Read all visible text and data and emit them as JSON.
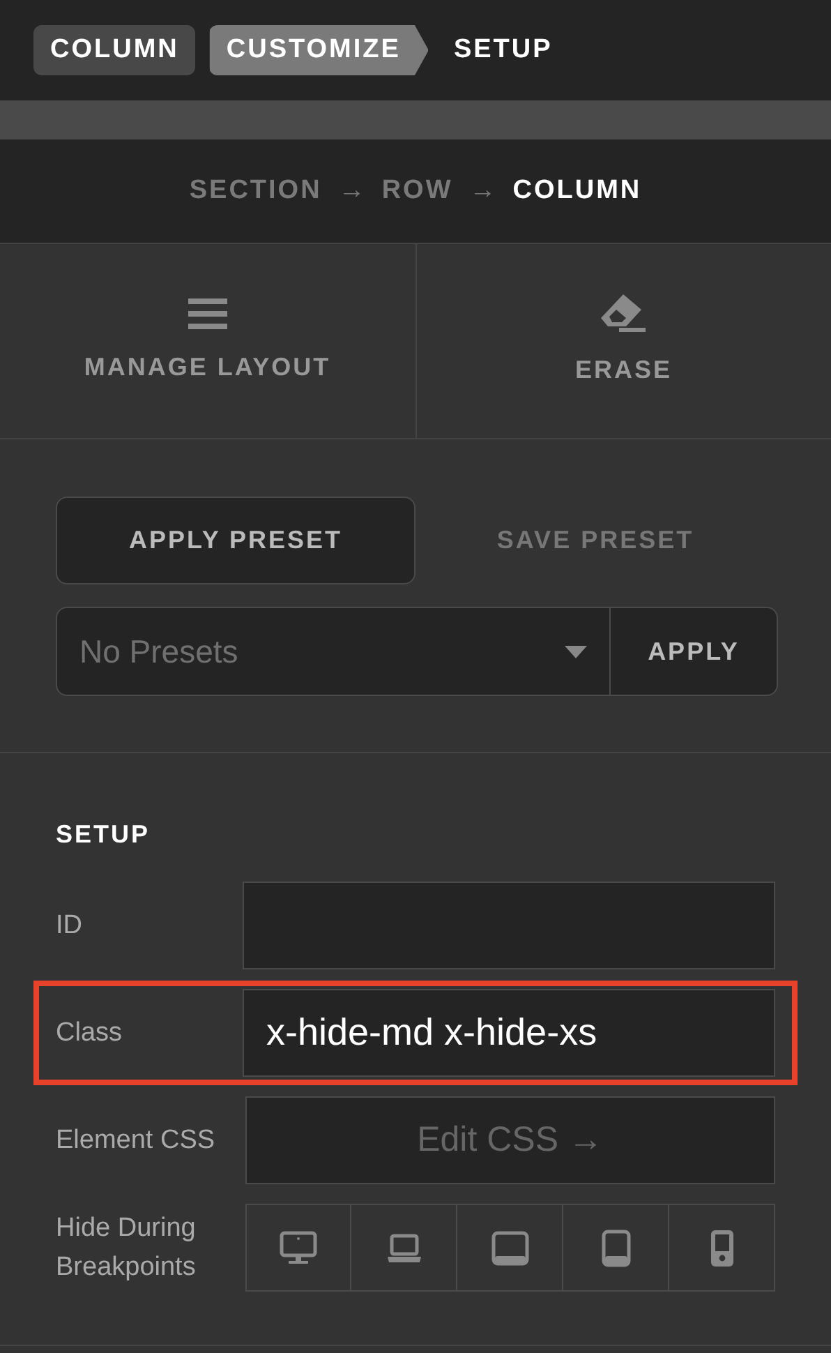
{
  "breadcrumb": [
    {
      "label": "COLUMN",
      "kind": "pill"
    },
    {
      "label": "CUSTOMIZE",
      "kind": "pointer"
    },
    {
      "label": "SETUP",
      "kind": "text"
    }
  ],
  "path": [
    {
      "label": "SECTION",
      "kind": "crumb",
      "selected": false
    },
    {
      "label": "→",
      "kind": "separator"
    },
    {
      "label": "ROW",
      "kind": "crumb",
      "selected": false
    },
    {
      "label": "→",
      "kind": "separator"
    },
    {
      "label": "COLUMN",
      "kind": "crumb",
      "selected": true
    }
  ],
  "actions": [
    {
      "label": "MANAGE LAYOUT",
      "kind": "menu"
    },
    {
      "label": "ERASE",
      "kind": "eraser"
    }
  ],
  "preset_tabs": [
    {
      "label": "APPLY PRESET",
      "selected": true
    },
    {
      "label": "SAVE PRESET",
      "selected": false
    }
  ],
  "preset_select": {
    "placeholder": "No Presets",
    "button": "APPLY"
  },
  "setup": {
    "title": "SETUP",
    "fields": [
      {
        "label": "ID",
        "kind": "text",
        "highlighted": false
      },
      {
        "label": "Class",
        "kind": "text",
        "value": "x-hide-md x-hide-xs",
        "highlighted": true
      },
      {
        "label": "Element CSS",
        "kind": "button",
        "button": "Edit CSS →",
        "highlighted": false
      },
      {
        "label": "Hide During Breakpoints",
        "kind": "breakpoints",
        "highlighted": false,
        "breakpoints": [
          {
            "kind": "desktop"
          },
          {
            "kind": "laptop"
          },
          {
            "kind": "tablet-landscape"
          },
          {
            "kind": "tablet"
          },
          {
            "kind": "phone"
          }
        ]
      }
    ]
  }
}
